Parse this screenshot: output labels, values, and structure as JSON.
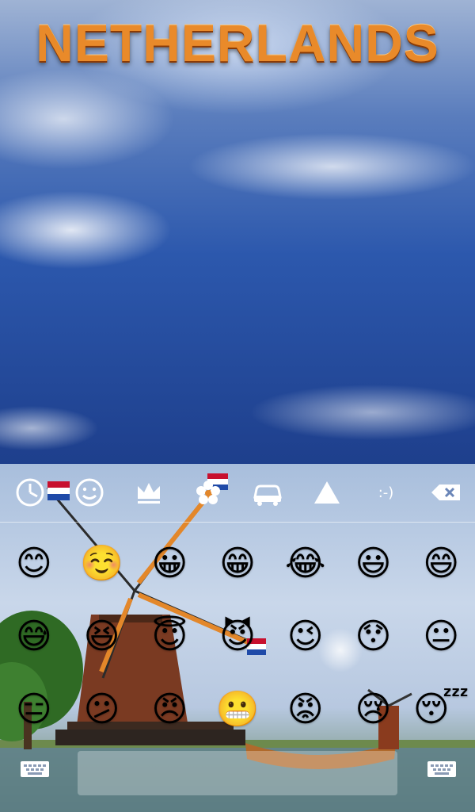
{
  "app_title": "NETHERLANDS",
  "categories": [
    {
      "name": "recent-icon"
    },
    {
      "name": "smiley-icon"
    },
    {
      "name": "crown-icon"
    },
    {
      "name": "flower-icon"
    },
    {
      "name": "car-icon"
    },
    {
      "name": "triangle-icon"
    },
    {
      "name": "emoticon-text",
      "label": ":-)"
    },
    {
      "name": "backspace-icon"
    }
  ],
  "emoji_rows": [
    [
      "😊",
      "☺️",
      "😀",
      "😁",
      "😂",
      "😃",
      "😄"
    ],
    [
      "😅",
      "😆",
      "😇",
      "😈",
      "😉",
      "😯",
      "😐"
    ],
    [
      "😑",
      "😕",
      "😠",
      "😬",
      "😡",
      "😢",
      "😴"
    ]
  ],
  "colors": {
    "title": "#e98a2a",
    "sky_top": "#9fb3d4",
    "sky_bottom": "#1e3f8c"
  }
}
